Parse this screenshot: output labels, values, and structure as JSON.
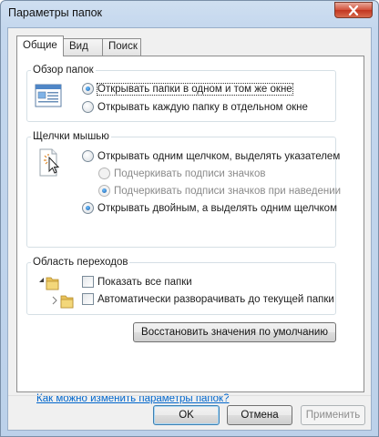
{
  "window": {
    "title": "Параметры папок"
  },
  "tabs": [
    {
      "label": "Общие",
      "active": true
    },
    {
      "label": "Вид",
      "active": false
    },
    {
      "label": "Поиск",
      "active": false
    }
  ],
  "browse": {
    "legend": "Обзор папок",
    "option_same_window": "Открывать папки в одном и том же окне",
    "option_separate_window": "Открывать каждую папку в отдельном окне",
    "selected": "same_window"
  },
  "clicks": {
    "legend": "Щелчки мышью",
    "option_single": "Открывать одним щелчком, выделять указателем",
    "sub_underline_always": "Подчеркивать подписи значков",
    "sub_underline_hover": "Подчеркивать подписи значков при наведении",
    "option_double": "Открывать двойным, а выделять одним щелчком",
    "selected": "double"
  },
  "nav": {
    "legend": "Область переходов",
    "show_all_folders": "Показать все папки",
    "auto_expand": "Автоматически разворачивать до текущей папки",
    "show_all_checked": false,
    "auto_expand_checked": false
  },
  "restore_label": "Восстановить значения по умолчанию",
  "help_link": "Как можно изменить параметры папок?",
  "buttons": {
    "ok": "OK",
    "cancel": "Отмена",
    "apply": "Применить"
  },
  "colors": {
    "link": "#0066cc",
    "accent": "#3c7fb1"
  }
}
